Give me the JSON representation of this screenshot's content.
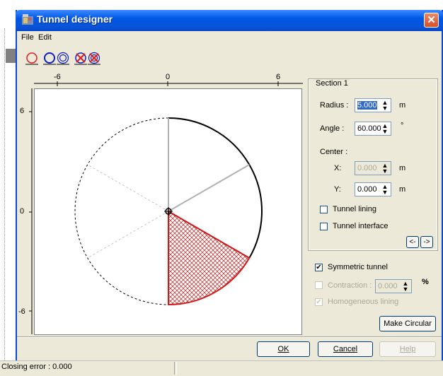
{
  "window": {
    "title": "Tunnel designer",
    "close_glyph": "✕"
  },
  "menu": {
    "file": "File",
    "edit": "Edit"
  },
  "toolbar": {
    "icons": [
      "red-circle-icon",
      "blue-circle-icon",
      "double-circle-icon",
      "delete-circle-icon",
      "delete-all-icon"
    ]
  },
  "plot": {
    "x_ticks": [
      "-6",
      "0",
      "6"
    ],
    "y_ticks": [
      "6",
      "0",
      "-6"
    ],
    "radius": 5.0,
    "section_angle_deg": 60
  },
  "section": {
    "title": "Section 1",
    "radius_label": "Radius :",
    "radius_value": "5.000",
    "radius_unit": "m",
    "angle_label": "Angle :",
    "angle_value": "60.000",
    "angle_unit": "°",
    "center_label": "Center :",
    "x_label": "X:",
    "x_value": "0.000",
    "x_unit": "m",
    "y_label": "Y:",
    "y_value": "0.000",
    "y_unit": "m",
    "lining_label": "Tunnel lining",
    "interface_label": "Tunnel interface",
    "prev_label": "<-",
    "next_label": "->"
  },
  "options": {
    "symmetric_label": "Symmetric tunnel",
    "symmetric_checked": true,
    "contraction_label": "Contraction :",
    "contraction_value": "0.000",
    "contraction_unit": "%",
    "homogeneous_label": "Homogeneous lining",
    "homogeneous_checked": true,
    "make_circular": "Make Circular"
  },
  "buttons": {
    "ok": "OK",
    "cancel": "Cancel",
    "help": "Help"
  },
  "status": {
    "closing_error": "Closing error : 0.000"
  }
}
